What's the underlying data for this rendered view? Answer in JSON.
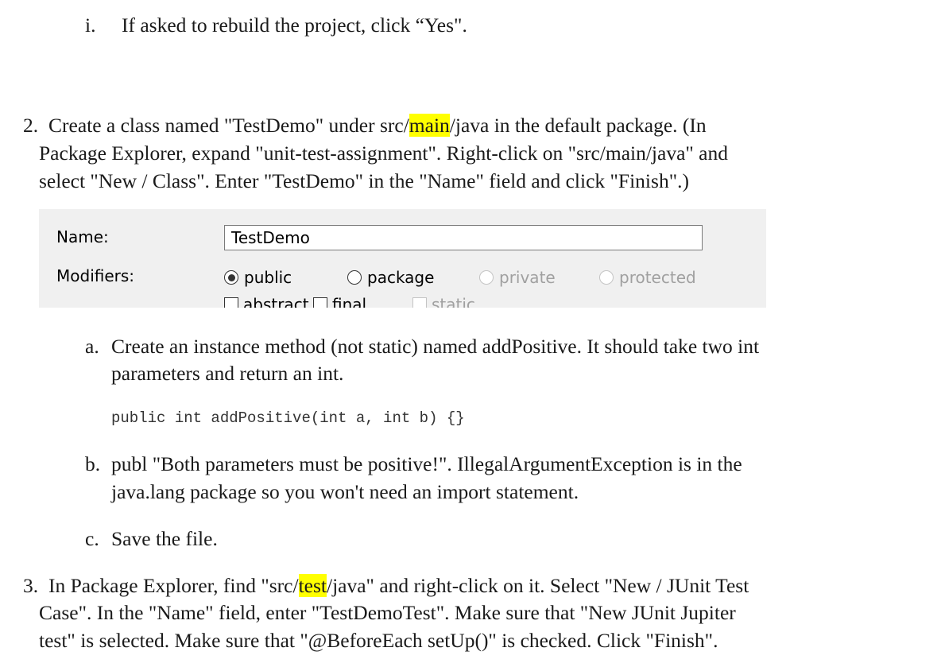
{
  "step1i": {
    "marker": "i.",
    "text": "If asked to rebuild the project, click “Yes\"."
  },
  "step2": {
    "marker": "2.",
    "line1_pre": "Create a class named \"TestDemo\" under src/",
    "line1_hl": "main",
    "line1_post": "/java in the default package. (In",
    "line2": "Package Explorer, expand \"unit-test-assignment\". Right-click on \"src/main/java\" and",
    "line3": "select \"New / Class\". Enter \"TestDemo\" in the \"Name\" field and click \"Finish\".)"
  },
  "dialog": {
    "name_label": "Name:",
    "name_value": "TestDemo",
    "modifiers_label": "Modifiers:",
    "radios": [
      {
        "label": "public",
        "selected": true,
        "disabled": false
      },
      {
        "label": "package",
        "selected": false,
        "disabled": false
      },
      {
        "label": "private",
        "selected": false,
        "disabled": true
      },
      {
        "label": "protected",
        "selected": false,
        "disabled": true
      }
    ],
    "checkboxes": [
      {
        "label": "abstract",
        "disabled": false
      },
      {
        "label": "final",
        "disabled": false
      },
      {
        "label": "static",
        "disabled": true
      }
    ]
  },
  "sub_a": {
    "marker": "a.",
    "line1": "Create an instance method (not static) named addPositive. It should take two int",
    "line2": "parameters and return an int.",
    "code": "public int addPositive(int a, int b) {}"
  },
  "sub_b": {
    "marker": "b.",
    "line1": "publ \"Both parameters must be positive!\". IllegalArgumentException is in the",
    "line2": "java.lang package so you won't need an import statement."
  },
  "sub_c": {
    "marker": "c.",
    "line1": "Save the file."
  },
  "step3": {
    "marker": "3.",
    "line1_pre": "In Package Explorer, find \"src/",
    "line1_hl": "test",
    "line1_post": "/java\" and right-click on it. Select \"New / JUnit Test",
    "line2": "Case\". In the \"Name\" field, enter \"TestDemoTest\". Make sure that \"New JUnit Jupiter",
    "line3": "test\" is selected. Make sure that \"@BeforeEach setUp()\" is checked. Click \"Finish\"."
  }
}
